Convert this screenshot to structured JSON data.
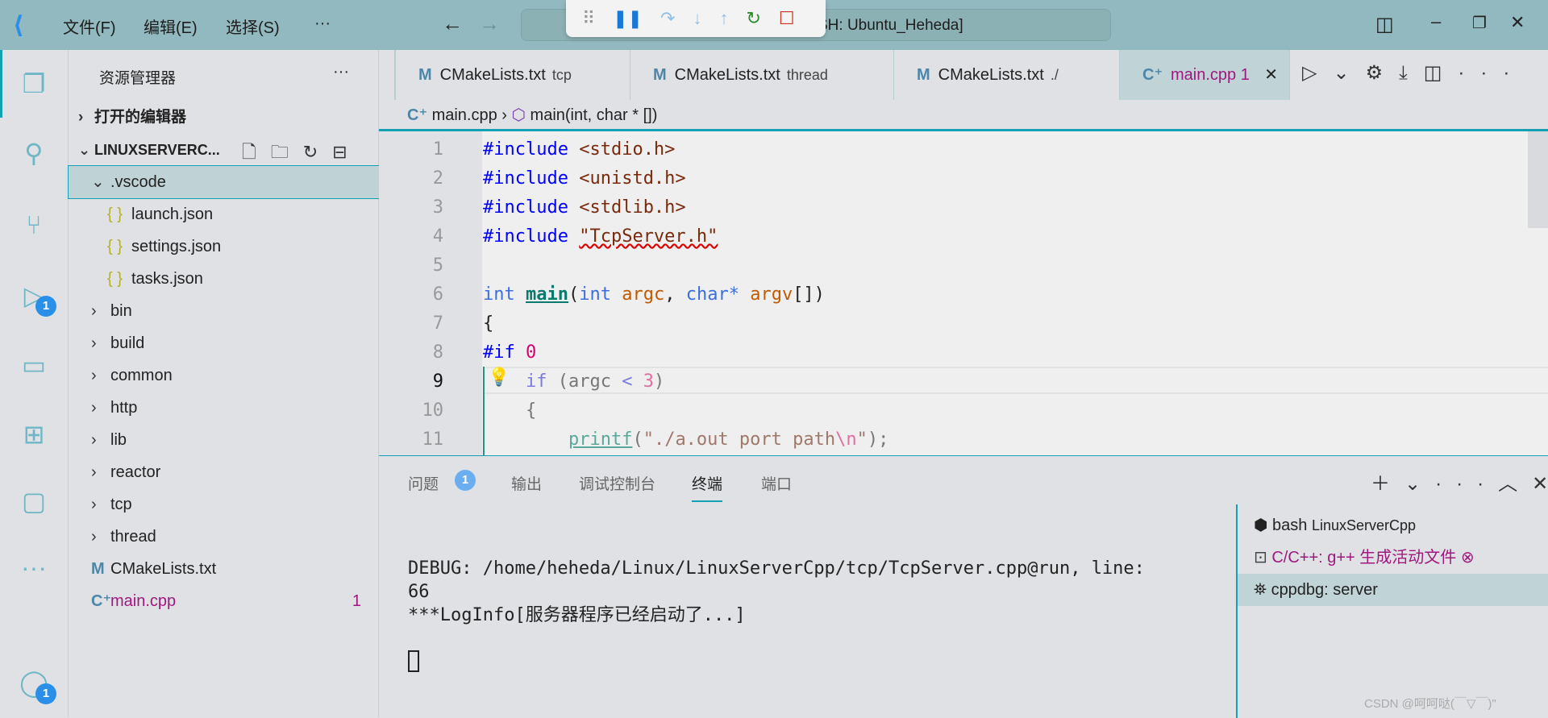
{
  "titlebar": {
    "menus": [
      "文件(F)",
      "编辑(E)",
      "选择(S)",
      "···"
    ],
    "command_center": "SH: Ubuntu_Heheda]"
  },
  "debug_toolbar": [
    "pause",
    "step-over",
    "step-into",
    "step-out",
    "restart",
    "stop"
  ],
  "activity": {
    "debug_badge": "1",
    "account_badge": "1"
  },
  "sidebar": {
    "title": "资源管理器",
    "more": "···",
    "open_editors": "打开的编辑器",
    "root": "LINUXSERVERC...",
    "items": [
      {
        "label": ".vscode",
        "type": "folder-open"
      },
      {
        "label": "launch.json",
        "type": "json"
      },
      {
        "label": "settings.json",
        "type": "json"
      },
      {
        "label": "tasks.json",
        "type": "json"
      },
      {
        "label": "bin",
        "type": "folder"
      },
      {
        "label": "build",
        "type": "folder"
      },
      {
        "label": "common",
        "type": "folder"
      },
      {
        "label": "http",
        "type": "folder"
      },
      {
        "label": "lib",
        "type": "folder"
      },
      {
        "label": "reactor",
        "type": "folder"
      },
      {
        "label": "tcp",
        "type": "folder"
      },
      {
        "label": "thread",
        "type": "folder"
      },
      {
        "label": "CMakeLists.txt",
        "type": "cmake"
      },
      {
        "label": "main.cpp",
        "type": "cpp",
        "problems": "1"
      }
    ]
  },
  "tabs": [
    {
      "label": "CMakeLists.txt",
      "desc": "tcp"
    },
    {
      "label": "CMakeLists.txt",
      "desc": "thread"
    },
    {
      "label": "CMakeLists.txt",
      "desc": "./"
    },
    {
      "label": "main.cpp",
      "desc": "1",
      "active": true
    }
  ],
  "breadcrumb": {
    "file": "main.cpp",
    "symbol": "main(int, char * [])"
  },
  "editor": {
    "line_numbers": [
      "1",
      "2",
      "3",
      "4",
      "5",
      "6",
      "7",
      "8",
      "9",
      "10",
      "11"
    ],
    "current_line": "9"
  },
  "panel": {
    "tabs": [
      "问题",
      "输出",
      "调试控制台",
      "终端",
      "端口"
    ],
    "problems_badge": "1",
    "active_tab": "终端",
    "terminal_lines": [
      "DEBUG: /home/heheda/Linux/LinuxServerCpp/tcp/TcpServer.cpp@run, line:",
      "66",
      "***LogInfo[服务器程序已经启动了...]"
    ],
    "terminals": [
      {
        "name": "bash",
        "desc": "LinuxServerCpp"
      },
      {
        "name": "C/C++: g++ 生成活动文件"
      },
      {
        "name": "cppdbg: server"
      }
    ]
  },
  "watermark": "CSDN @呵呵哒(￣▽￣)\"",
  "colors": {
    "accent": "#14a0b4",
    "titlebar": "#92b9bf",
    "modified_file": "#a0187e"
  }
}
